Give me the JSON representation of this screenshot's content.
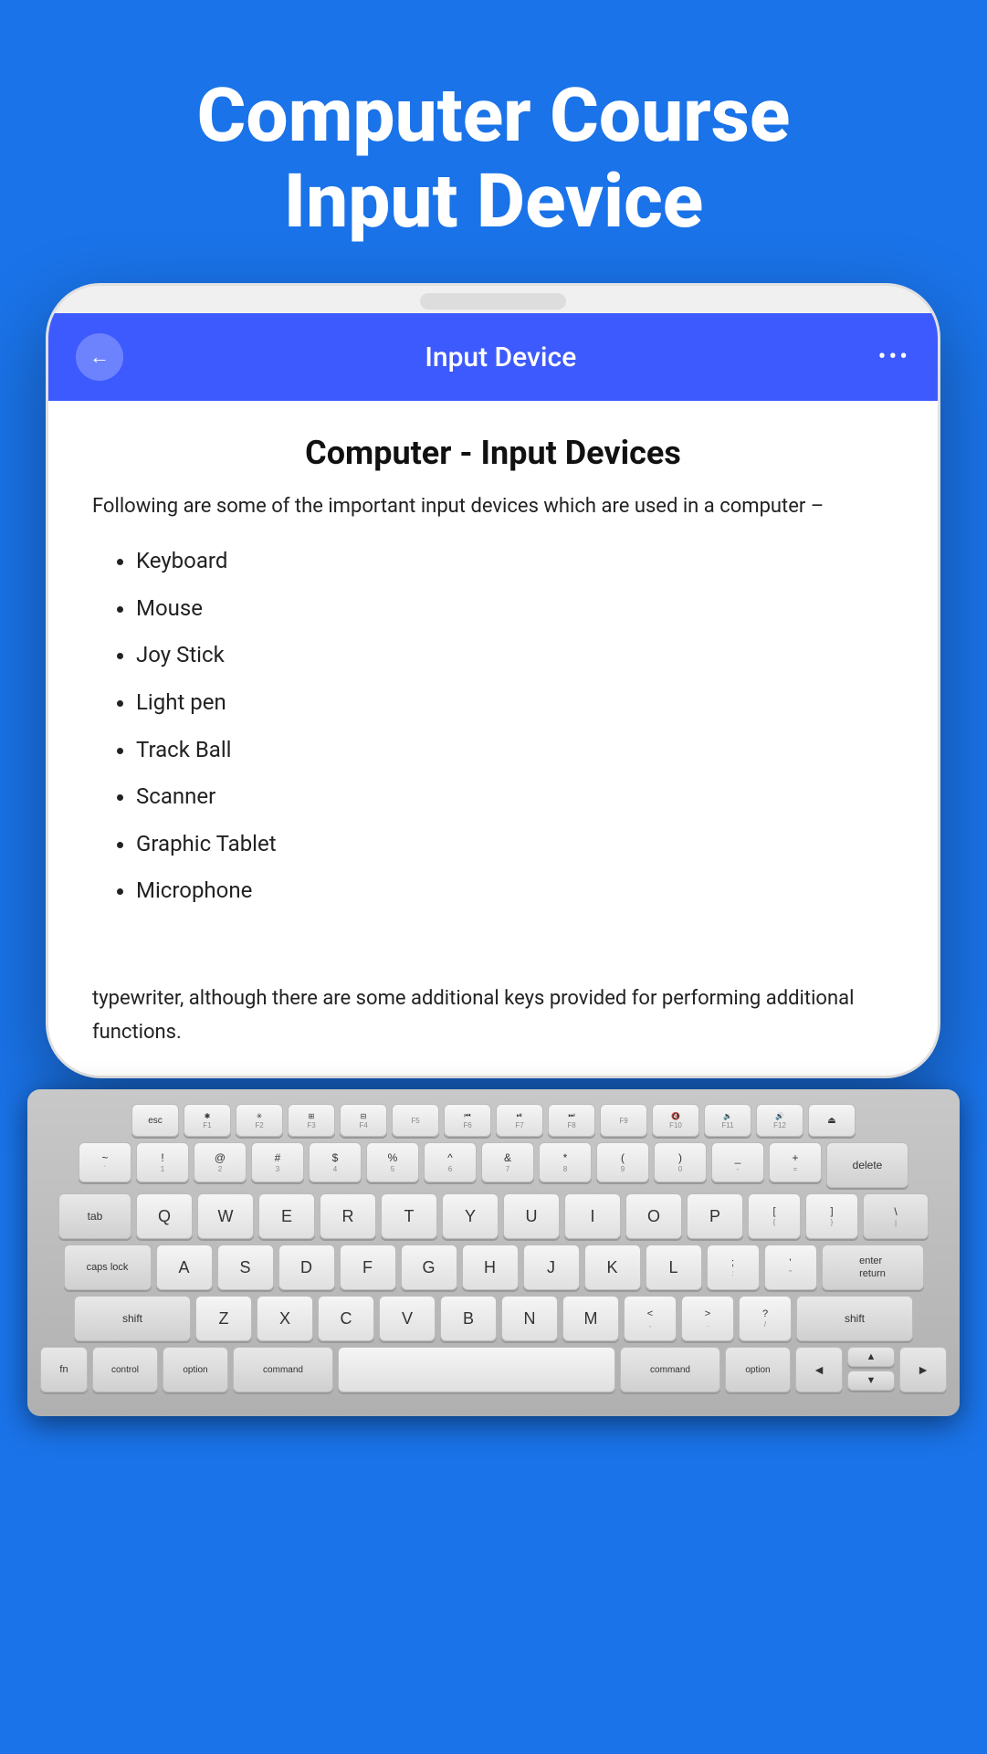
{
  "header": {
    "line1": "Computer Course",
    "line2": "Input Device"
  },
  "app": {
    "title": "Input Device",
    "back_label": "←",
    "more_label": "•••"
  },
  "content": {
    "title": "Computer - Input Devices",
    "intro": "Following are some of the important input devices which are used in a computer –",
    "devices": [
      "Keyboard",
      "Mouse",
      "Joy Stick",
      "Light pen",
      "Track Ball",
      "Scanner",
      "Graphic Tablet",
      "Microphone"
    ],
    "bottom_text": "typewriter, although there are some additional keys provided for performing additional functions."
  },
  "keyboard": {
    "fn_row": [
      "esc",
      "F1",
      "F2",
      "F3",
      "F4",
      "F5",
      "F6",
      "F7",
      "F8",
      "F9",
      "F10",
      "F11",
      "F12",
      "⏏"
    ],
    "num_row": [
      "~`",
      "!1",
      "@2",
      "#3",
      "$4",
      "%5",
      "^6",
      "&7",
      "*8",
      "(9",
      ")0",
      "_-",
      "+=",
      "delete"
    ],
    "row1": [
      "tab",
      "Q",
      "W",
      "E",
      "R",
      "T",
      "Y",
      "U",
      "I",
      "O",
      "P",
      "[{",
      "]}",
      "\\|"
    ],
    "row2": [
      "caps lock",
      "A",
      "S",
      "D",
      "F",
      "G",
      "H",
      "J",
      "K",
      "L",
      ";:",
      ",\"",
      "enter\nreturn"
    ],
    "row3": [
      "shift",
      "Z",
      "X",
      "C",
      "V",
      "B",
      "N",
      "M",
      "<,",
      ">.",
      "?/",
      "shift"
    ],
    "row4": [
      "fn",
      "control",
      "option",
      "command",
      "",
      "command",
      "option",
      "◄",
      "▼▲",
      "►"
    ]
  }
}
